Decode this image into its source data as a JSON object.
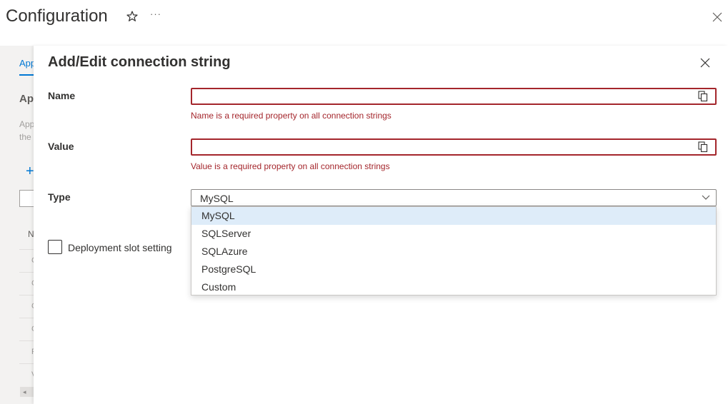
{
  "header": {
    "title": "Configuration",
    "more_label": "···"
  },
  "background": {
    "tab_label": "App",
    "heading": "Ap",
    "description_line1": "App",
    "description_line2": "the",
    "column_header": "N",
    "rows": [
      "C",
      "C",
      "C",
      "C",
      "P",
      "V"
    ]
  },
  "dialog": {
    "title": "Add/Edit connection string",
    "name": {
      "label": "Name",
      "value": "",
      "error": "Name is a required property on all connection strings"
    },
    "value": {
      "label": "Value",
      "value": "",
      "error": "Value is a required property on all connection strings"
    },
    "type": {
      "label": "Type",
      "selected": "MySQL",
      "options": [
        "MySQL",
        "SQLServer",
        "SQLAzure",
        "PostgreSQL",
        "Custom"
      ]
    },
    "slot_setting": {
      "label": "Deployment slot setting",
      "checked": false
    }
  },
  "colors": {
    "accent": "#0078d4",
    "error": "#a4262c",
    "option_highlight": "#deecf9"
  }
}
